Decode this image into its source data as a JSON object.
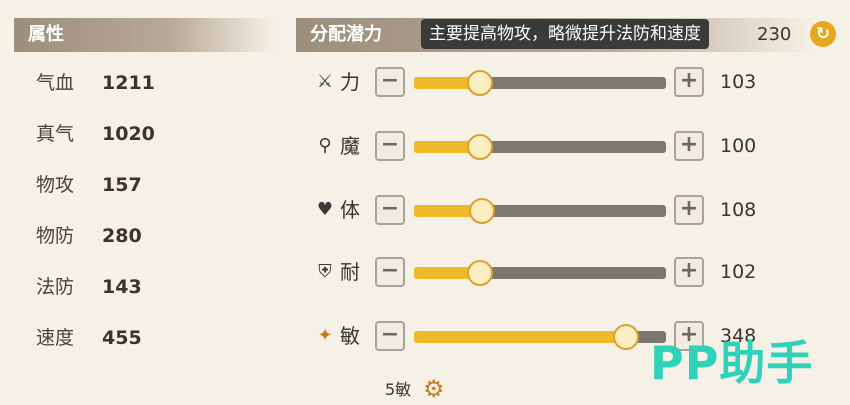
{
  "left_panel": {
    "title": "属性",
    "stats": [
      {
        "label": "气血",
        "value": "1211"
      },
      {
        "label": "真气",
        "value": "1020"
      },
      {
        "label": "物攻",
        "value": "157"
      },
      {
        "label": "物防",
        "value": "280"
      },
      {
        "label": "法防",
        "value": "143"
      },
      {
        "label": "速度",
        "value": "455"
      }
    ]
  },
  "right_panel": {
    "title": "分配潜力",
    "tooltip": "主要提高物攻，略微提升法防和速度",
    "remaining_points": "230",
    "attributes": [
      {
        "name": "力",
        "icon": "sword-icon",
        "value": "103",
        "fill_fraction": 0.26
      },
      {
        "name": "魔",
        "icon": "staff-icon",
        "value": "100",
        "fill_fraction": 0.26
      },
      {
        "name": "体",
        "icon": "heart-icon",
        "value": "108",
        "fill_fraction": 0.27
      },
      {
        "name": "耐",
        "icon": "shield-icon",
        "value": "102",
        "fill_fraction": 0.26
      },
      {
        "name": "敏",
        "icon": "boot-icon",
        "value": "348",
        "fill_fraction": 0.84
      }
    ],
    "minus_label": "−",
    "plus_label": "+"
  },
  "footer": {
    "label": "5敏"
  },
  "watermark": "PP助手",
  "colors": {
    "fill": "#efb92c",
    "track": "#7c7870",
    "watermark": "#2fd1b8"
  }
}
